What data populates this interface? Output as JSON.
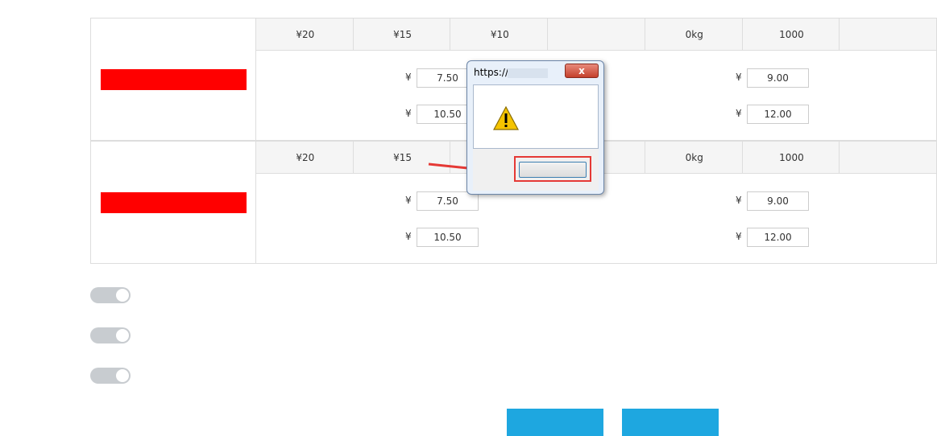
{
  "section": {
    "title": "",
    "close": ""
  },
  "blocks": [
    {
      "color_name": "",
      "header": [
        {
          "label": "",
          "value": "¥20"
        },
        {
          "label": "",
          "value": "¥15"
        },
        {
          "label": "",
          "value": "¥10"
        },
        {
          "label": "",
          "value": ""
        },
        {
          "label": "",
          "value": "0kg"
        },
        {
          "label": "",
          "value": "1000"
        },
        {
          "label": "",
          "value": ""
        }
      ],
      "prices": [
        {
          "label": "",
          "value": "7.50"
        },
        {
          "label": "",
          "value": "9.00"
        },
        {
          "label": "",
          "value": "10.50"
        },
        {
          "label": "",
          "value": "12.00"
        }
      ]
    },
    {
      "color_name": "",
      "header": [
        {
          "label": "",
          "value": "¥20"
        },
        {
          "label": "",
          "value": "¥15"
        },
        {
          "label": "",
          "value": ""
        },
        {
          "label": "",
          "value": ""
        },
        {
          "label": "",
          "value": "0kg"
        },
        {
          "label": "",
          "value": "1000"
        },
        {
          "label": "",
          "value": ""
        }
      ],
      "prices": [
        {
          "label": "",
          "value": "7.50"
        },
        {
          "label": "",
          "value": "9.00"
        },
        {
          "label": "",
          "value": "10.50"
        },
        {
          "label": "",
          "value": "12.00"
        }
      ]
    }
  ],
  "currency_symbol": "¥",
  "toggles": [
    {
      "label": "",
      "state": "",
      "description": ""
    },
    {
      "label": "",
      "state": "",
      "description": ""
    },
    {
      "label": "",
      "state": "",
      "description": ""
    }
  ],
  "buttons": {
    "save": "",
    "cancel": ""
  },
  "dialog": {
    "title": "https://pr",
    "close": "x",
    "message": "",
    "ok": ""
  },
  "colors": {
    "tag_red": "#ff0000",
    "button_blue": "#1ea7e0",
    "highlight_red": "#e53935",
    "link_blue": "#1a73e8"
  }
}
